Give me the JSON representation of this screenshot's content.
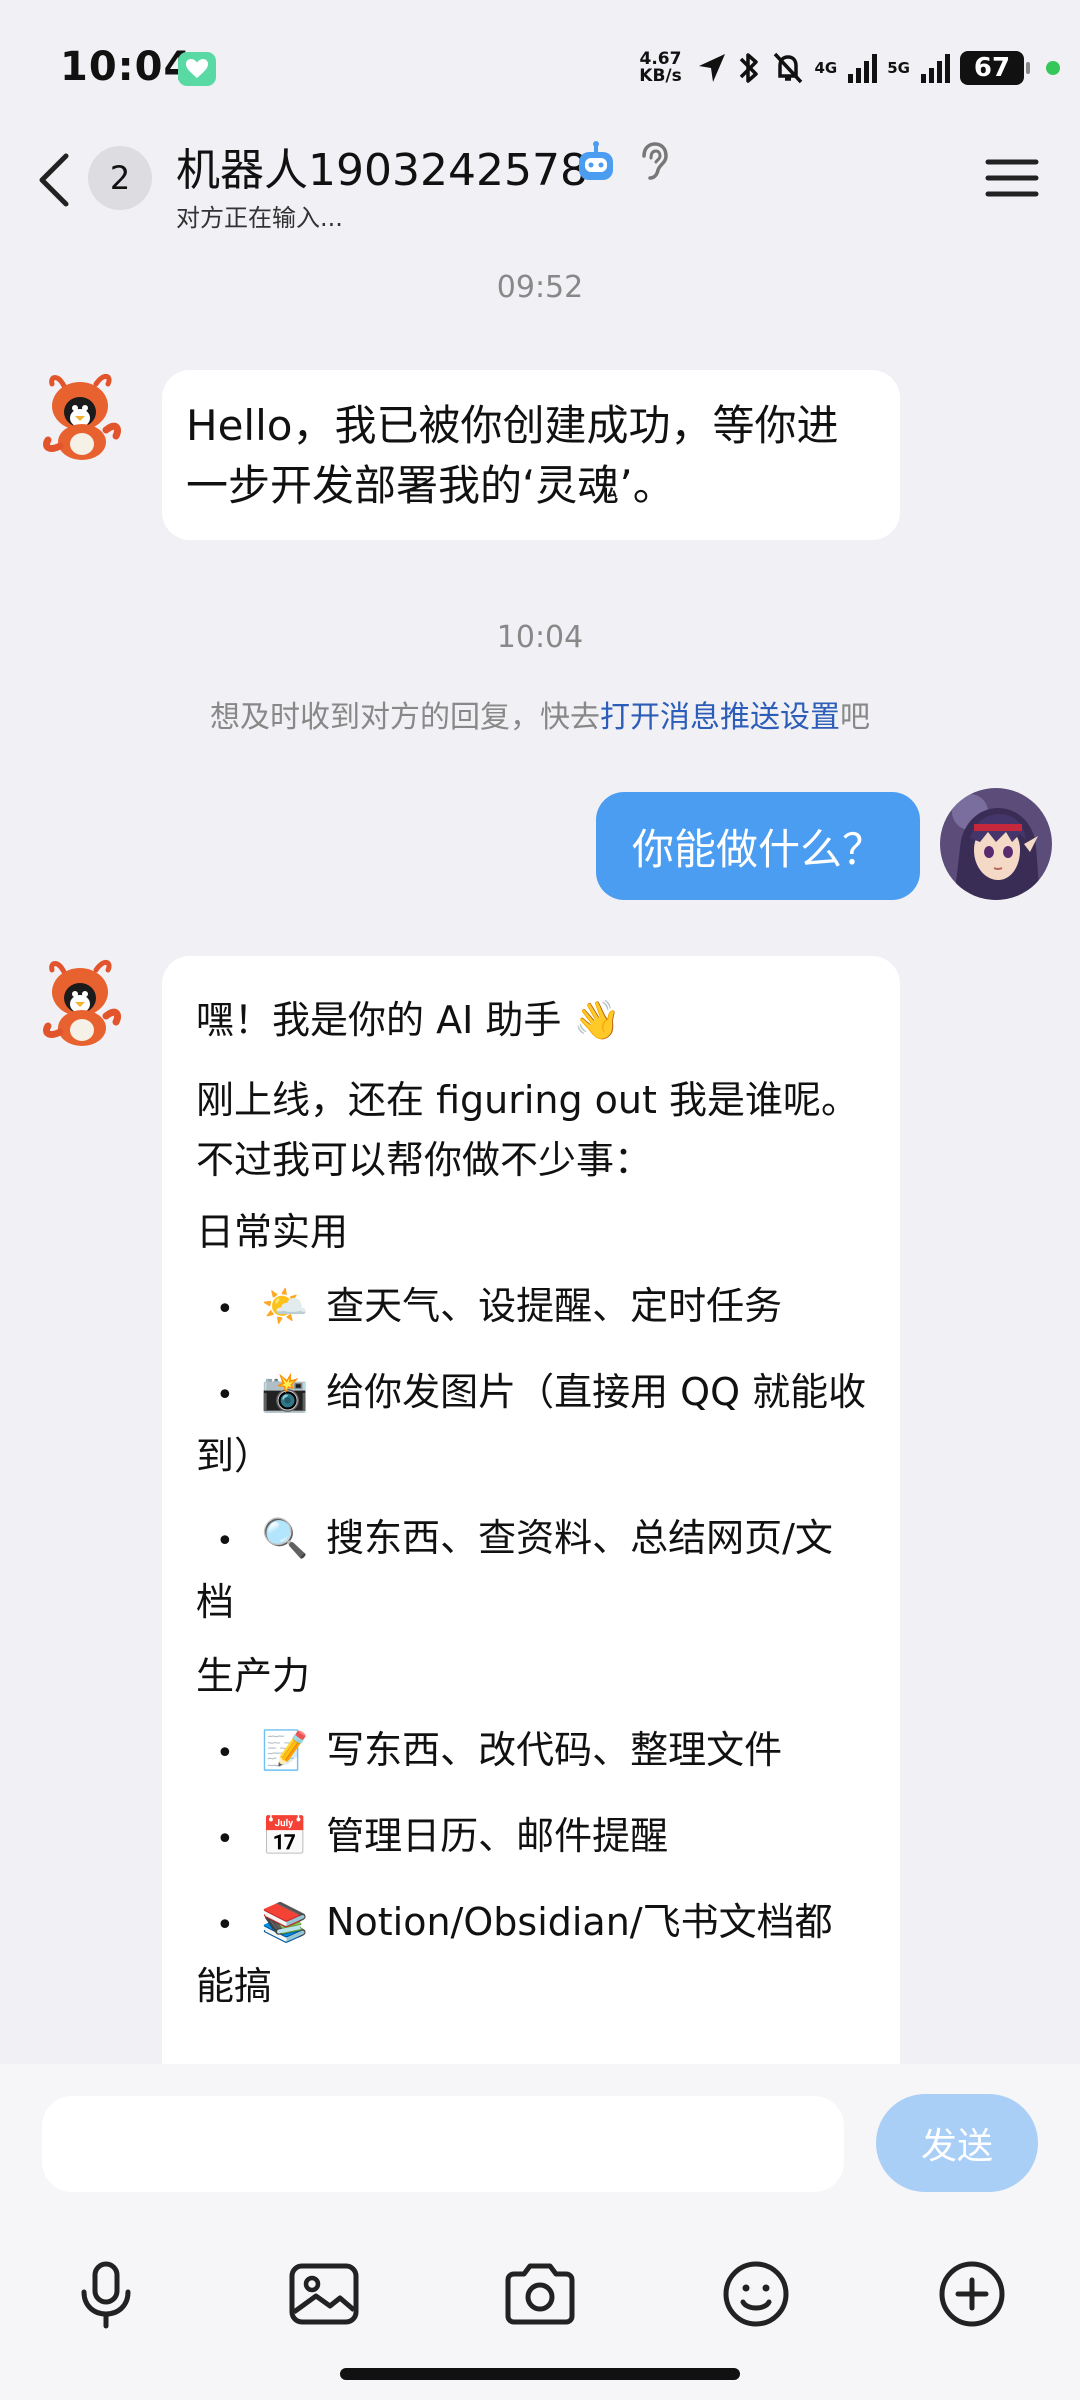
{
  "status_bar": {
    "time": "10:04",
    "net_speed_value": "4.67",
    "net_speed_unit": "KB/s",
    "signal_1": "4G",
    "signal_2": "5G",
    "battery": "67"
  },
  "header": {
    "unread_count": "2",
    "title": "机器人1903242578",
    "subtitle": "对方正在输入..."
  },
  "messages": {
    "timestamp_1": "09:52",
    "bot_msg_1": "Hello，我已被你创建成功，等你进一步开发部署我的‘灵魂’。",
    "timestamp_2": "10:04",
    "notice_prefix": "想及时收到对方的回复，快去",
    "notice_link": "打开消息推送设置",
    "notice_suffix": "吧",
    "user_msg": "你能做什么？",
    "bot_msg_2": {
      "intro": "嘿！我是你的 AI 助手 👋",
      "para": "刚上线，还在 figuring out 我是谁呢。不过我可以帮你做不少事：",
      "section_1": "日常实用",
      "section_1_items": [
        {
          "emoji": "🌤️",
          "text": "查天气、设提醒、定时任务"
        },
        {
          "emoji": "📸",
          "text": "给你发图片（直接用 QQ 就能收到）"
        },
        {
          "emoji": "🔍",
          "text": "搜东西、查资料、总结网页/文档"
        }
      ],
      "section_2": "生产力",
      "section_2_items": [
        {
          "emoji": "📝",
          "text": "写东西、改代码、整理文件"
        },
        {
          "emoji": "📅",
          "text": "管理日历、邮件提醒"
        },
        {
          "emoji": "📚",
          "text": "Notion/Obsidian/飞书文档都能搞"
        }
      ]
    }
  },
  "input": {
    "placeholder": "",
    "send_label": "发送"
  },
  "toolbar_icons": [
    "microphone-icon",
    "image-icon",
    "camera-icon",
    "emoji-icon",
    "plus-icon"
  ]
}
